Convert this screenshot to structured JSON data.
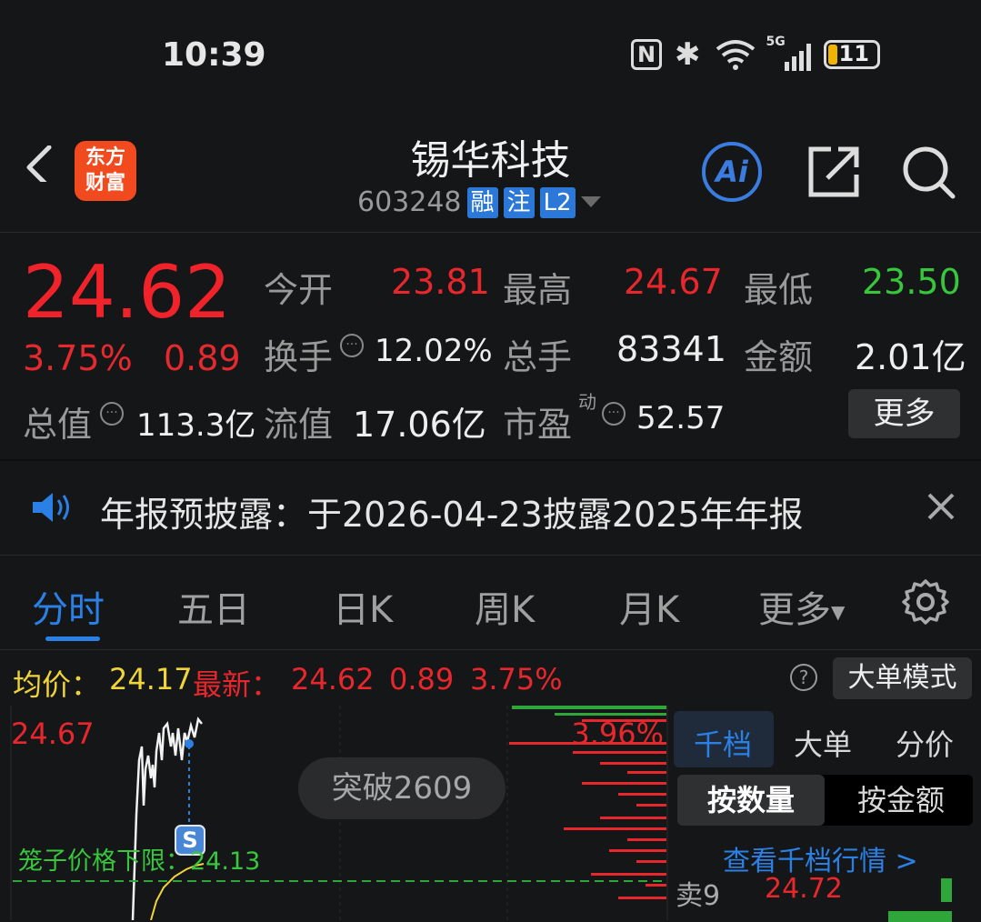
{
  "status_bar": {
    "time": "10:39",
    "battery": "11",
    "network": "5G",
    "icons": [
      "nfc-icon",
      "bluetooth-icon",
      "wifi-icon",
      "signal-icon",
      "battery-icon"
    ]
  },
  "header": {
    "title": "锡华科技",
    "code": "603248",
    "tags": [
      "融",
      "注",
      "L2"
    ],
    "logo_text": [
      "东方",
      "财富"
    ],
    "ai_label": "Ai"
  },
  "quote": {
    "price": "24.62",
    "change_pct": "3.75%",
    "change": "0.89",
    "open_label": "今开",
    "open": "23.81",
    "high_label": "最高",
    "high": "24.67",
    "low_label": "最低",
    "low": "23.50",
    "turnover_label": "换手",
    "turnover": "12.02%",
    "volume_label": "总手",
    "volume": "83341",
    "amount_label": "金额",
    "amount": "2.01亿",
    "mcap_label": "总值",
    "mcap": "113.3亿",
    "float_label": "流值",
    "float_cap": "17.06亿",
    "pe_label": "市盈",
    "pe_super": "动",
    "pe": "52.57",
    "more_label": "更多"
  },
  "notice": {
    "text": "年报预披露：于2026-04-23披露2025年年报"
  },
  "tabs": {
    "items": [
      "分时",
      "五日",
      "日K",
      "周K",
      "月K",
      "更多"
    ],
    "active": "分时"
  },
  "avg_bar": {
    "avg_label": "均价：",
    "avg": "24.17",
    "latest_label": "最新：",
    "latest": "24.62",
    "change": "0.89",
    "pct": "3.75%",
    "mode_label": "大单模式"
  },
  "chart": {
    "top_price": "24.67",
    "top_pct": "3.96%",
    "badge": "突破2609",
    "limit_label": "笼子价格下限：24.13",
    "signal": "S"
  },
  "panel": {
    "tabs": [
      "千档",
      "大单",
      "分价"
    ],
    "active_tab": "千档",
    "toggle": [
      "按数量",
      "按金额"
    ],
    "link": "查看千档行情 >",
    "row_label": "卖9",
    "row_price": "24.72"
  },
  "colors": {
    "up": "#e8272d",
    "down": "#38c63c",
    "accent": "#2b80e6",
    "avg": "#f0d43a"
  }
}
